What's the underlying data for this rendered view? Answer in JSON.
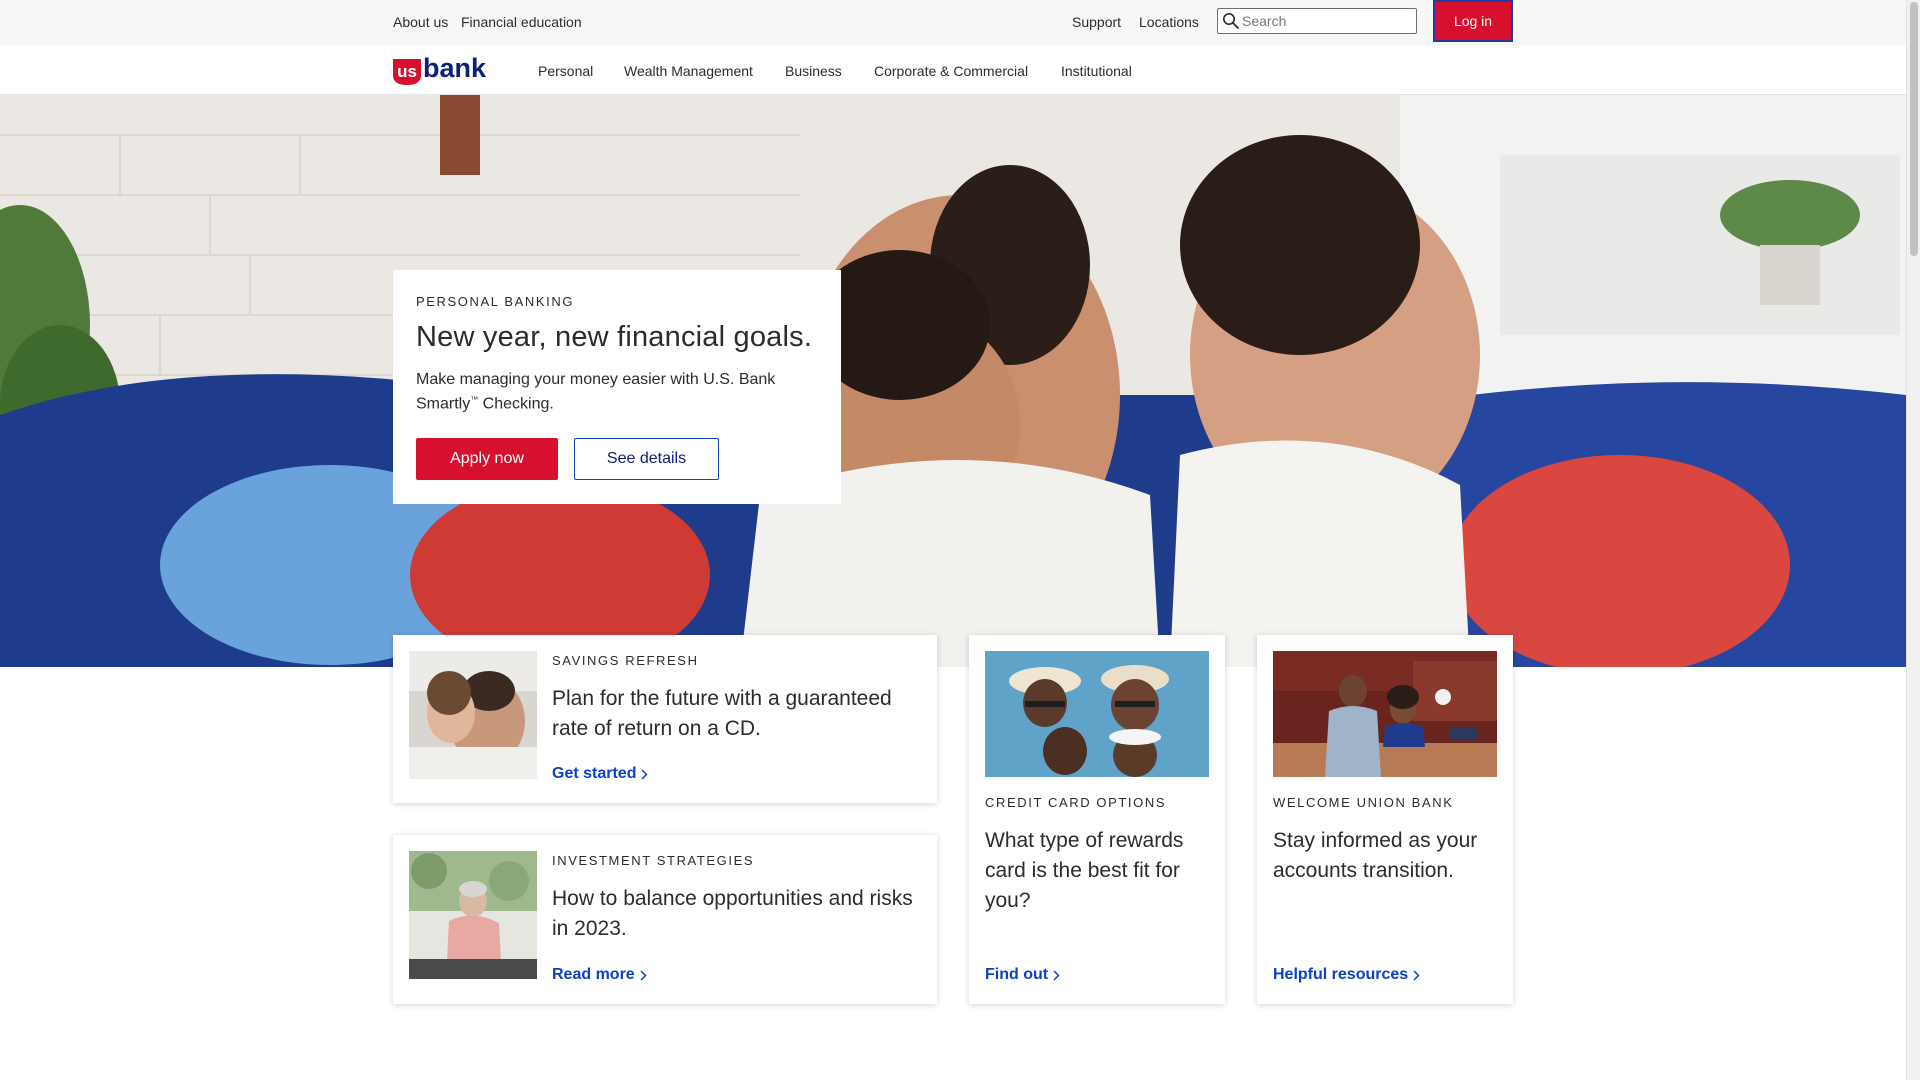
{
  "utility": {
    "about": "About us",
    "financial_education": "Financial education",
    "support": "Support",
    "locations": "Locations",
    "search_placeholder": "Search",
    "login": "Log in"
  },
  "brand": {
    "logo_us": "us",
    "logo_bank": "bank",
    "colors": {
      "red": "#d8102f",
      "navy": "#0c2074",
      "link_blue": "#0a41c5"
    }
  },
  "nav": {
    "items": [
      "Personal",
      "Wealth Management",
      "Business",
      "Corporate & Commercial",
      "Institutional"
    ]
  },
  "hero": {
    "eyebrow": "PERSONAL BANKING",
    "title": "New year, new financial goals.",
    "body_pre": "Make managing your money easier with U.S. Bank Smartly",
    "body_tm": "™",
    "body_post": " Checking.",
    "apply": "Apply now",
    "details": "See details"
  },
  "cards": [
    {
      "eyebrow": "SAVINGS REFRESH",
      "title": "Plan for the future with a guaranteed rate of return on a CD.",
      "link": "Get started",
      "image_icon": "father-daughter-hug-photo"
    },
    {
      "eyebrow": "INVESTMENT STRATEGIES",
      "title": "How to balance opportunities and risks in 2023.",
      "link": "Read more",
      "image_icon": "woman-reading-photo"
    },
    {
      "eyebrow": "CREDIT CARD OPTIONS",
      "title": "What type of rewards card is the best fit for you?",
      "link": "Find out",
      "image_icon": "family-sunglasses-photo"
    },
    {
      "eyebrow": "WELCOME UNION BANK",
      "title": "Stay informed as your accounts transition.",
      "link": "Helpful resources",
      "image_icon": "bank-branch-photo"
    }
  ]
}
